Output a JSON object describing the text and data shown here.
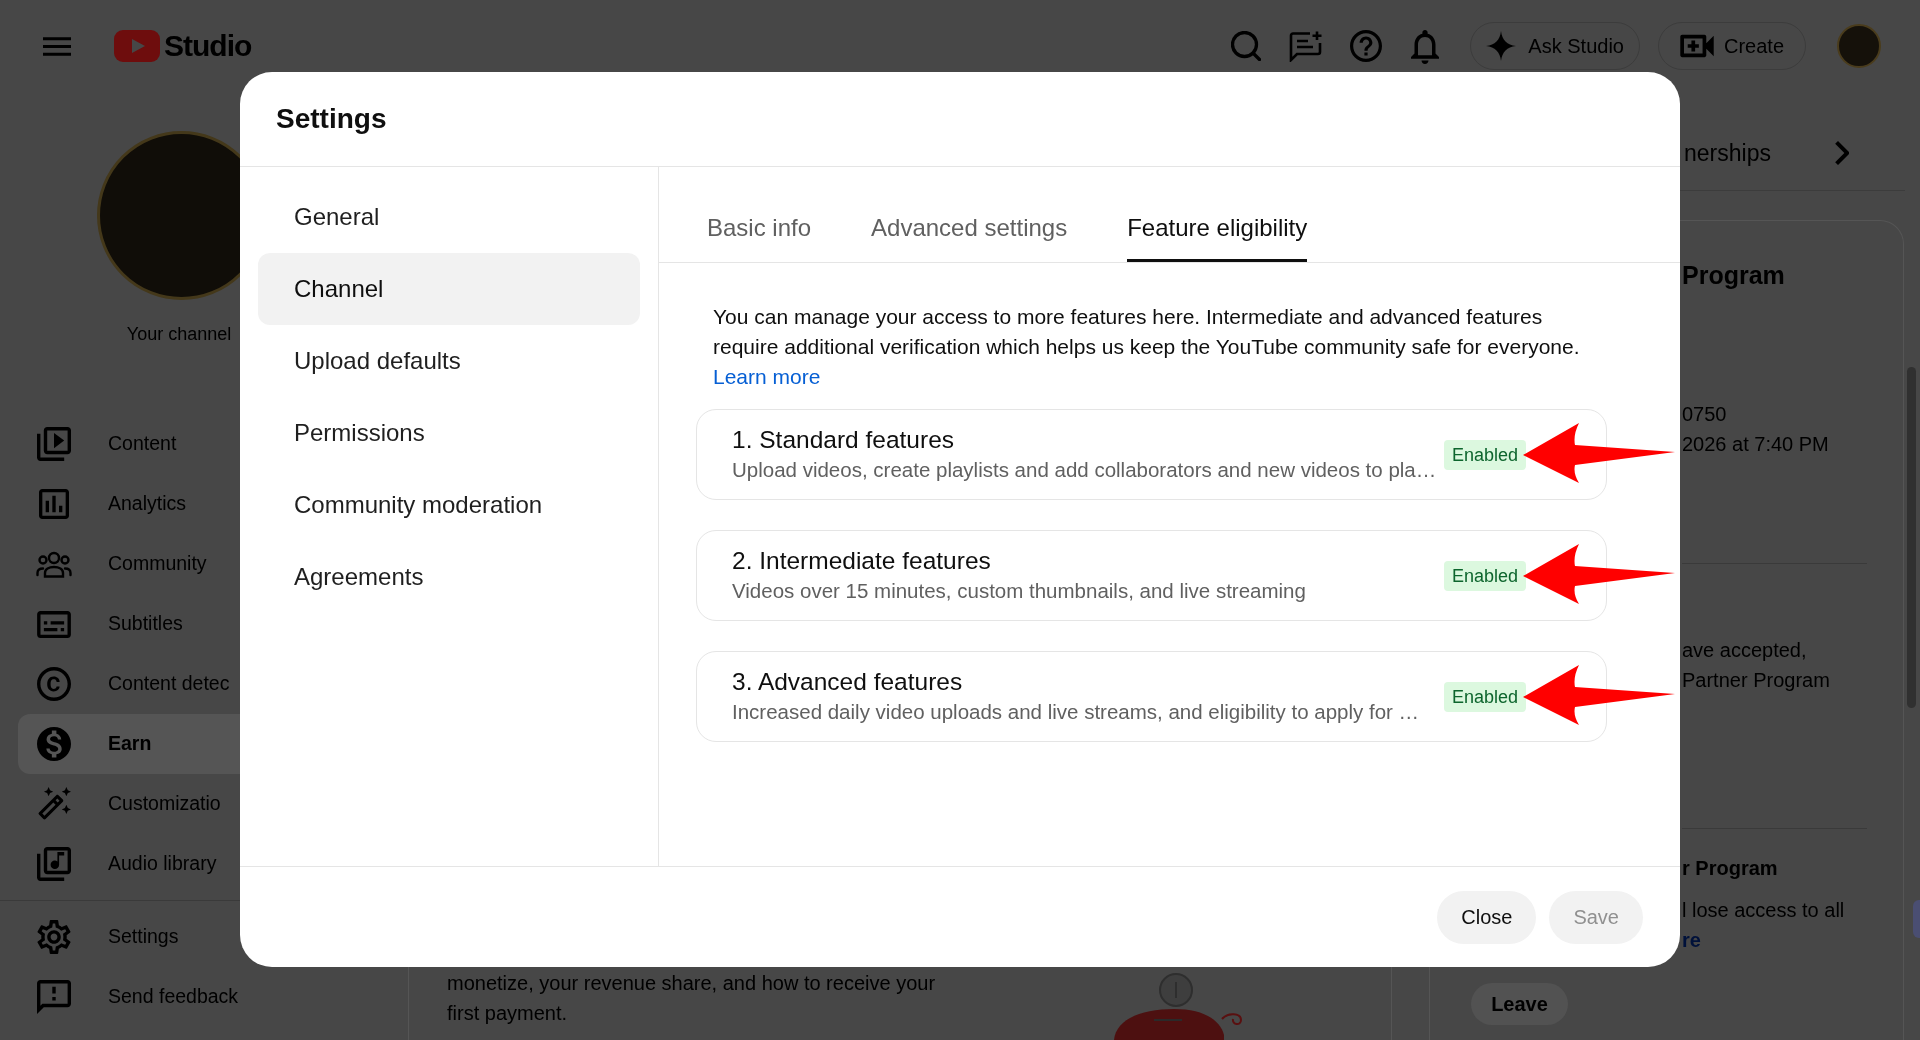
{
  "topbar": {
    "logo_text": "Studio",
    "ask_button": "Ask Studio",
    "create_button": "Create"
  },
  "sidebar": {
    "channel_label": "Your channel",
    "items": [
      {
        "label": "Content",
        "selected": false
      },
      {
        "label": "Analytics",
        "selected": false
      },
      {
        "label": "Community",
        "selected": false
      },
      {
        "label": "Subtitles",
        "selected": false
      },
      {
        "label": "Content detec",
        "selected": false
      },
      {
        "label": "Earn",
        "selected": true
      },
      {
        "label": "Customizatio",
        "selected": false
      },
      {
        "label": "Audio library",
        "selected": false
      }
    ],
    "bottom_items": [
      {
        "label": "Settings",
        "selected": false
      },
      {
        "label": "Send feedback",
        "selected": false
      }
    ]
  },
  "page": {
    "tab": "nerships",
    "summary": "monetize, your revenue share, and how to receive your first payment.",
    "status_card": {
      "title": "Program",
      "details": [
        "0750",
        "2026 at 7:40 PM"
      ],
      "terms": [
        "ave accepted,",
        "Partner Program"
      ],
      "leave_title": "r Program",
      "leave_text": "l lose access to all",
      "leave_link": "re",
      "leave_button": "Leave"
    }
  },
  "dialog": {
    "title": "Settings",
    "nav": [
      {
        "label": "General",
        "selected": false
      },
      {
        "label": "Channel",
        "selected": true
      },
      {
        "label": "Upload defaults",
        "selected": false
      },
      {
        "label": "Permissions",
        "selected": false
      },
      {
        "label": "Community moderation",
        "selected": false
      },
      {
        "label": "Agreements",
        "selected": false
      }
    ],
    "tabs": [
      {
        "label": "Basic info",
        "selected": false
      },
      {
        "label": "Advanced settings",
        "selected": false
      },
      {
        "label": "Feature eligibility",
        "selected": true
      }
    ],
    "intro": "You can manage your access to more features here. Intermediate and advanced features require additional verification which helps us keep the YouTube community safe for everyone.",
    "learn_more": "Learn more",
    "features": [
      {
        "title": "1. Standard features",
        "description": "Upload videos, create playlists and add collaborators and new videos to pla…",
        "status": "Enabled",
        "annotated": true
      },
      {
        "title": "2. Intermediate features",
        "description": "Videos over 15 minutes, custom thumbnails, and live streaming",
        "status": "Enabled",
        "annotated": true
      },
      {
        "title": "3. Advanced features",
        "description": "Increased daily video uploads and live streams, and eligibility to apply for …",
        "status": "Enabled",
        "annotated": true
      }
    ],
    "buttons": [
      {
        "label": "Close",
        "disabled": false
      },
      {
        "label": "Save",
        "disabled": true
      }
    ]
  }
}
